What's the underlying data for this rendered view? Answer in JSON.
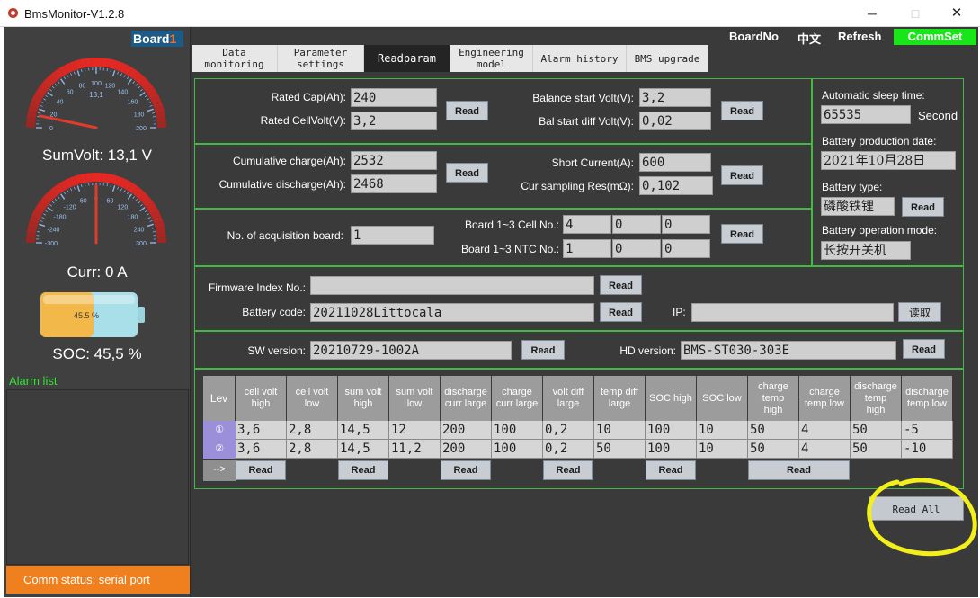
{
  "window": {
    "title": "BmsMonitor-V1.2.8",
    "minimize": "─",
    "maximize": "□",
    "close": "✕"
  },
  "left": {
    "board_label": "Board",
    "board_num": "1",
    "sumvolt": {
      "label": "SumVolt: 13,1 V",
      "center_value": "13,1",
      "ticks": [
        "0",
        "20",
        "40",
        "60",
        "80",
        "100",
        "120",
        "140",
        "160",
        "180",
        "200"
      ],
      "value_fraction": 0.066
    },
    "curr": {
      "label": "Curr: 0 A",
      "ticks": [
        "-300",
        "-240",
        "-180",
        "-120",
        "-60",
        "0",
        "60",
        "120",
        "180",
        "240",
        "300"
      ],
      "value_fraction": 0.5
    },
    "soc": {
      "label": "SOC: 45,5 %",
      "percent_text": "45.5 %",
      "fraction": 0.455
    },
    "alarm_title": "Alarm list",
    "comm_status": "Comm status: serial port"
  },
  "toolbar": {
    "boardno": "BoardNo",
    "lang": "中文",
    "refresh": "Refresh",
    "commset": "CommSet"
  },
  "tabs": [
    {
      "label": "Data\nmonitoring",
      "active": false
    },
    {
      "label": "Parameter\nsettings",
      "active": false
    },
    {
      "label": "Readparam",
      "active": true
    },
    {
      "label": "Engineering\nmodel",
      "active": false
    },
    {
      "label": "Alarm history",
      "active": false
    },
    {
      "label": "BMS upgrade",
      "active": false
    }
  ],
  "params": {
    "rated_cap_label": "Rated Cap(Ah):",
    "rated_cap": "240",
    "rated_cellvolt_label": "Rated CellVolt(V):",
    "rated_cellvolt": "3,2",
    "balance_start_label": "Balance start Volt(V):",
    "balance_start": "3,2",
    "bal_diff_label": "Bal start diff Volt(V):",
    "bal_diff": "0,02",
    "cum_charge_label": "Cumulative charge(Ah):",
    "cum_charge": "2532",
    "cum_discharge_label": "Cumulative discharge(Ah):",
    "cum_discharge": "2468",
    "short_current_label": "Short Current(A):",
    "short_current": "600",
    "cur_sampling_label": "Cur sampling Res(mΩ):",
    "cur_sampling": "0,102",
    "acq_board_label": "No. of acquisition board:",
    "acq_board": "1",
    "cell_no_label": "Board 1~3 Cell No.:",
    "cell_no": [
      "4",
      "0",
      "0"
    ],
    "ntc_no_label": "Board 1~3 NTC No.:",
    "ntc_no": [
      "1",
      "0",
      "0"
    ],
    "sleep_label": "Automatic sleep time:",
    "sleep": "65535",
    "sleep_unit": "Second",
    "prod_date_label": "Battery production date:",
    "prod_date": "2021年10月28日",
    "bat_type_label": "Battery type:",
    "bat_type": "磷酸铁锂",
    "op_mode_label": "Battery operation mode:",
    "op_mode": "长按开关机",
    "firmware_label": "Firmware Index No.:",
    "firmware": "",
    "bat_code_label": "Battery code:",
    "bat_code": "20211028Littocala",
    "ip_label": "IP:",
    "ip": "",
    "ip_read": "读取",
    "sw_label": "SW version:",
    "sw": "20210729-1002A",
    "hd_label": "HD version:",
    "hd": "BMS-ST030-303E",
    "read": "Read"
  },
  "table": {
    "headers": [
      "Lev",
      "cell volt\nhigh",
      "cell volt\nlow",
      "sum volt\nhigh",
      "sum volt\nlow",
      "discharge\ncurr large",
      "charge\ncurr large",
      "volt diff\nlarge",
      "temp diff\nlarge",
      "SOC high",
      "SOC low",
      "charge\ntemp\nhigh",
      "charge\ntemp low",
      "discharge\ntemp\nhigh",
      "discharge\ntemp low"
    ],
    "rows": [
      {
        "lev": "①",
        "values": [
          "3,6",
          "2,8",
          "14,5",
          "12",
          "200",
          "100",
          "0,2",
          "10",
          "100",
          "10",
          "50",
          "4",
          "50",
          "-5"
        ]
      },
      {
        "lev": "②",
        "values": [
          "3,6",
          "2,8",
          "14,5",
          "11,2",
          "200",
          "100",
          "0,2",
          "50",
          "100",
          "10",
          "50",
          "4",
          "50",
          "-10"
        ]
      }
    ],
    "arrow": "-->",
    "read": "Read"
  },
  "read_all": "Read All",
  "colors": {
    "panel_border": "#43b843",
    "commset": "#19e619",
    "comm_status": "#f07f1d",
    "annotation": "#f2ef1a"
  }
}
